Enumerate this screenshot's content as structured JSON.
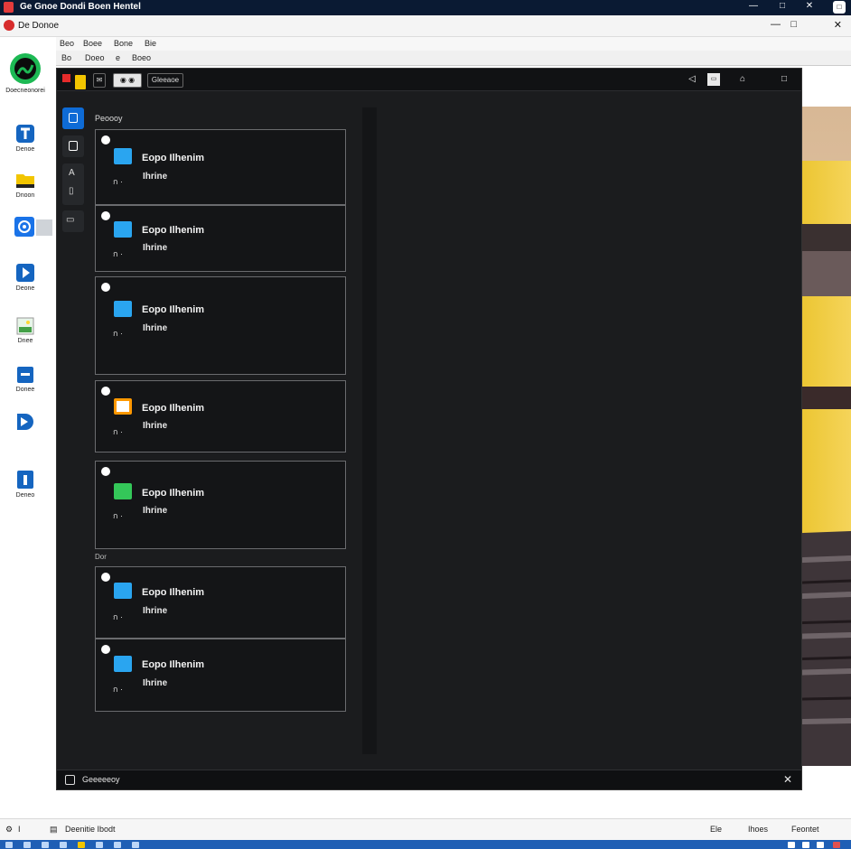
{
  "window": {
    "title": "Ge Gnoe  Dondi  Boen  Hentel",
    "controls": {
      "minimize": "—",
      "maximize": "□",
      "close": "✕",
      "extra": "□"
    }
  },
  "appbar": {
    "name": "De  Donoe",
    "controls": [
      "—",
      "□",
      "✕"
    ]
  },
  "menubar": {
    "items": [
      "Beo",
      "Boee",
      "Bone",
      "Bie"
    ]
  },
  "toolbar2": {
    "items": [
      "Bo",
      "Doeo",
      "e",
      "Boeo"
    ]
  },
  "launcher": {
    "items": [
      {
        "label": "Doecneonorei",
        "icon": "music-app-icon",
        "color": "#1db954"
      },
      {
        "label": "Denoe",
        "icon": "letter-app-icon",
        "color": "#1565c0"
      },
      {
        "label": "Dnoon",
        "icon": "folder-icon",
        "color": "#f2c500"
      },
      {
        "label": "",
        "icon": "settings-app-icon",
        "color": "#1a73e8"
      },
      {
        "label": "Deone",
        "icon": "play-icon",
        "color": "#1565c0"
      },
      {
        "label": "Dnee",
        "icon": "image-app-icon",
        "color": "#43a047"
      },
      {
        "label": "Donee",
        "icon": "window-app-icon",
        "color": "#1565c0"
      },
      {
        "label": "",
        "icon": "video-app-icon",
        "color": "#1565c0"
      },
      {
        "label": "Deneo",
        "icon": "calendar-app-icon",
        "color": "#1565c0"
      }
    ]
  },
  "darkwin": {
    "tab_label": "Gleeaoe",
    "panel_title": "Peoooy",
    "section2_label": "Dor",
    "bottom_label": "Geeeeeoy",
    "cards": [
      {
        "name": "Eopo Ilhenim",
        "status": "Ihrine",
        "meta": "ก ·",
        "icon_color": "#2aa5f0"
      },
      {
        "name": "Eopo Ilhenim",
        "status": "Ihrine",
        "meta": "ก ·",
        "icon_color": "#2aa5f0"
      },
      {
        "name": "Eopo Ilhenim",
        "status": "Ihrine",
        "meta": "ก ·",
        "icon_color": "#2aa5f0"
      },
      {
        "name": "Eopo Ilhenim",
        "status": "Ihrine",
        "meta": "ก ·",
        "icon_color": "#ff9800"
      },
      {
        "name": "Eopo Ilhenim",
        "status": "Ihrine",
        "meta": "ก ·",
        "icon_color": "#34c759"
      },
      {
        "name": "Eopo Ilhenim",
        "status": "Ihrine",
        "meta": "ก ·",
        "icon_color": "#2aa5f0"
      },
      {
        "name": "Eopo Ilhenim",
        "status": "Ihrine",
        "meta": "ก ·",
        "icon_color": "#2aa5f0"
      }
    ]
  },
  "statusbar": {
    "left_label": "Deenitie Ibodt",
    "right_items": [
      "Ele",
      "Ihoes",
      "Feontet"
    ]
  }
}
